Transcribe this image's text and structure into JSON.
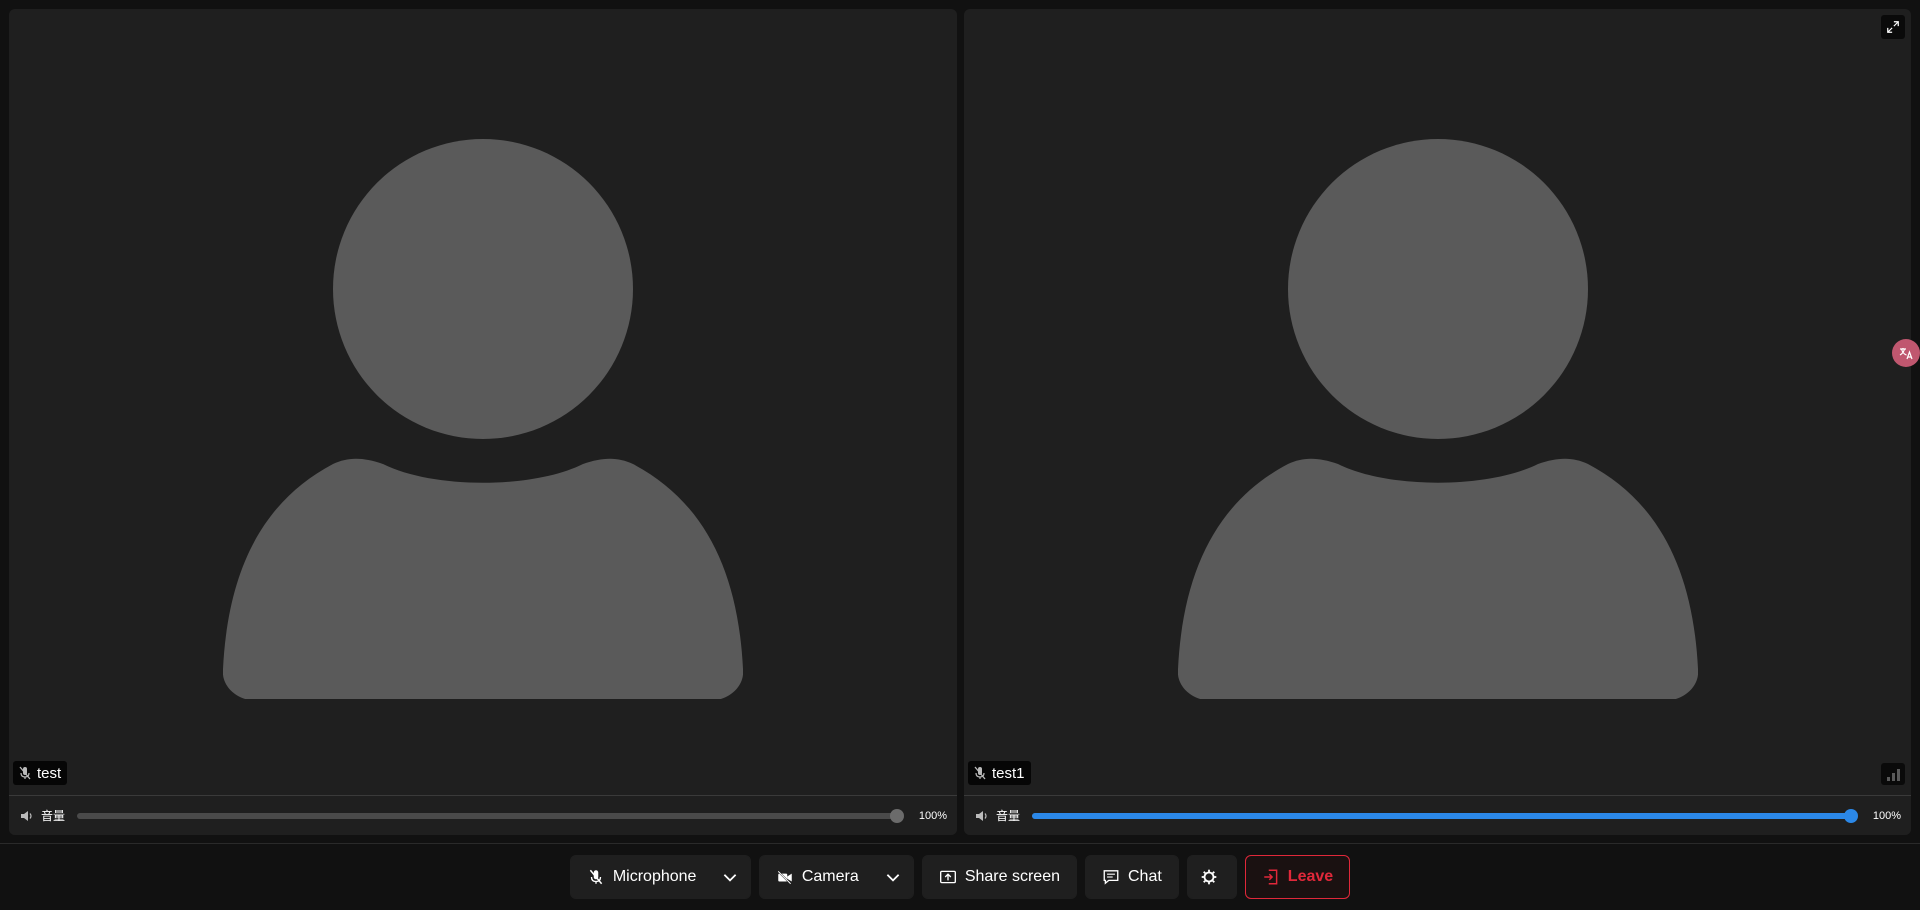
{
  "tiles": [
    {
      "participant_name": "test",
      "volume_label": "音量",
      "volume_percent_text": "100%",
      "volume_fraction": 1.0,
      "slider_color": "#6b6b6b"
    },
    {
      "participant_name": "test1",
      "volume_label": "音量",
      "volume_percent_text": "100%",
      "volume_fraction": 1.0,
      "slider_color": "#2b88e8"
    }
  ],
  "controls": {
    "microphone_label": "Microphone",
    "camera_label": "Camera",
    "share_label": "Share screen",
    "chat_label": "Chat",
    "leave_label": "Leave"
  },
  "colors": {
    "leave": "#e0283a",
    "accent": "#2b88e8",
    "avatar": "#5a5a5a"
  }
}
